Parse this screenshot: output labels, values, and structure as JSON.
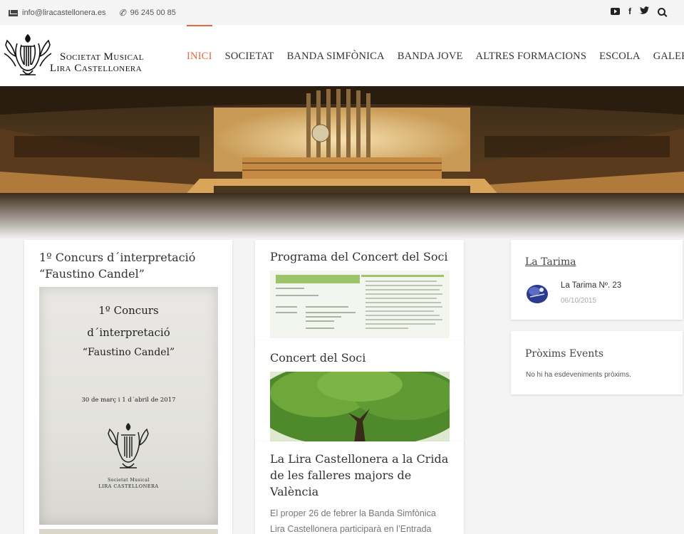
{
  "topbar": {
    "email": "info@liracastellonera.es",
    "phone": "96 245 00 85",
    "social": [
      "youtube-icon",
      "facebook-icon",
      "twitter-icon",
      "search-icon"
    ]
  },
  "logo": {
    "line1": "Societat Musical",
    "line2": "Lira Castellonera"
  },
  "nav": {
    "items": [
      "INICI",
      "SOCIETAT",
      "BANDA SIMFÒNICA",
      "BANDA JOVE",
      "ALTRES FORMACIONS",
      "ESCOLA",
      "GALERIA"
    ],
    "active_index": 0,
    "accent": "#e46a3a"
  },
  "cards": {
    "concurs": {
      "title": "1º Concurs d´interpretació “Faustino Candel”",
      "poster_l1": "1º Concurs",
      "poster_l2": "d´interpretació",
      "poster_l3": "“Faustino Candel”",
      "poster_date": "30 de març i 1 d´abril de 2017",
      "poster_org1": "Societat Musical",
      "poster_org2": "LIRA CASTELLONERA"
    },
    "programa": {
      "title": "Programa del Concert del Soci"
    },
    "concert": {
      "title": "Concert del Soci"
    },
    "crida": {
      "title": "La Lira Castellonera a la Crida de les falleres majors de València",
      "excerpt": "El proper 26 de febrer la Banda Simfònica Lira Castellonera participarà en l’Entrada"
    }
  },
  "widgets": {
    "tarima": {
      "title": "La Tarima",
      "item": "La Tarima Nº. 23",
      "date": "06/10/2015"
    },
    "events": {
      "title": "Pròxims Events",
      "empty": "No hi ha esdeveniments pròxims."
    }
  }
}
